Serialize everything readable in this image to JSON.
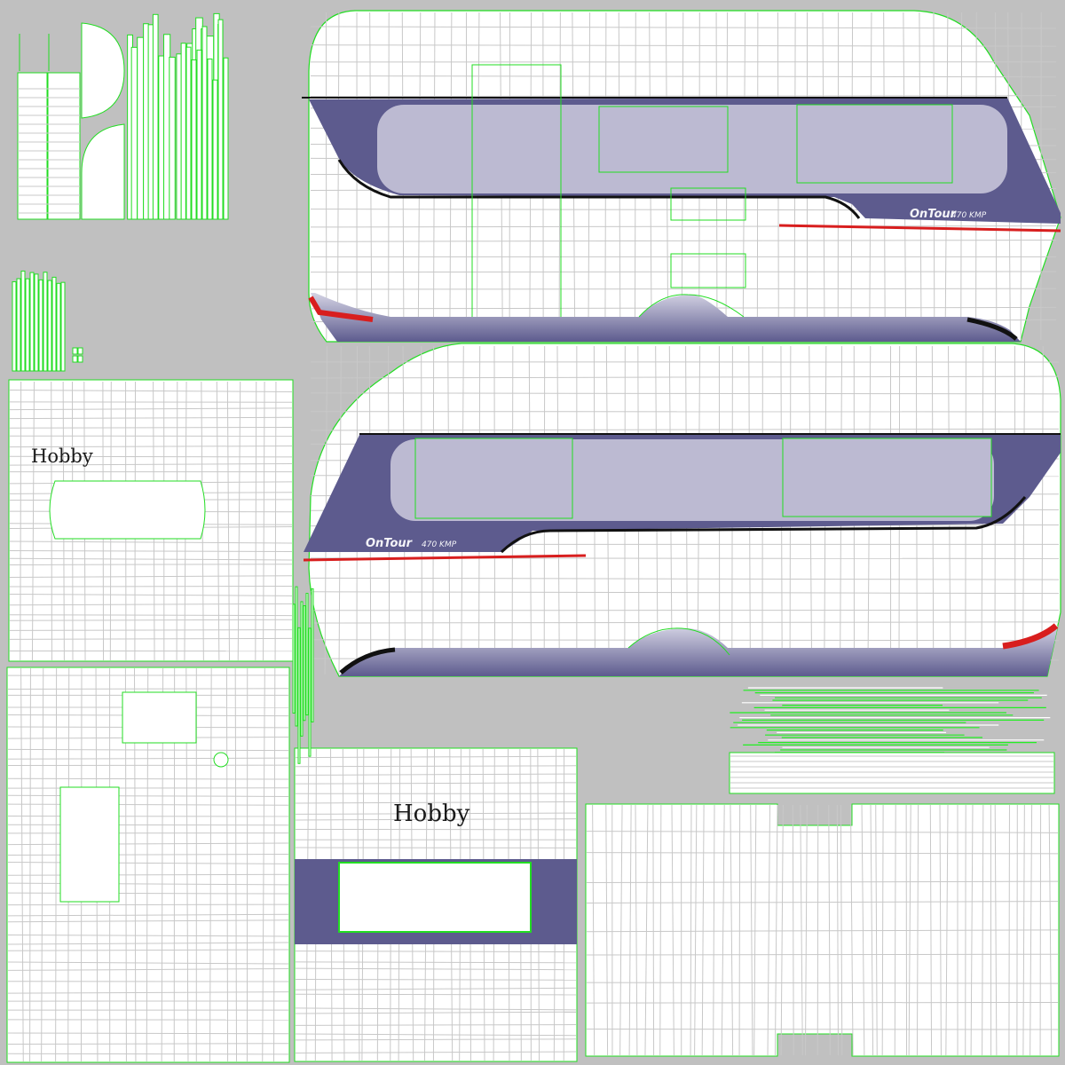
{
  "texture": {
    "brand_labels": [
      "Hobby",
      "Hobby"
    ],
    "model_name": "OnTour",
    "model_code": "470 KMP"
  },
  "palette": {
    "background": "#c0c0c0",
    "panel_fill": "#ffffff",
    "wire_line": "#c8c8c8",
    "uv_seam": "#22dd22",
    "stripe_dark": "#5d5b8e",
    "stripe_light": "#bcbad2",
    "accent_red": "#d81e1e",
    "accent_black": "#111111"
  }
}
